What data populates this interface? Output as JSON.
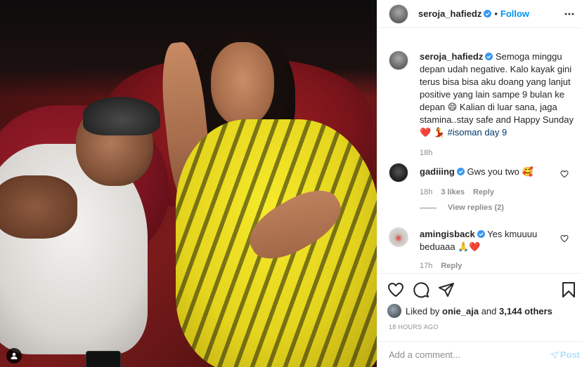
{
  "post": {
    "author": "seroja_hafiedz",
    "follow_label": "Follow",
    "caption_author": "seroja_hafiedz",
    "caption": "Semoga minggu depan udah negative. Kalo kayak gini terus bisa bisa aku doang yang lanjut positive yang lain sampe 9 bulan ke depan 😄 Kalian di luar sana, jaga stamina..stay safe and Happy Sunday",
    "caption_tail": "#isoman day 9",
    "caption_emoji": "❤️ 💃",
    "caption_time": "18h"
  },
  "comments": [
    {
      "username": "gadiiing",
      "text": "Gws you two 🥰",
      "time": "18h",
      "likes": "3 likes",
      "reply": "Reply",
      "view_replies": "View replies (2)"
    },
    {
      "username": "amingisback",
      "text": "Yes kmuuuu beduaaa 🙏❤️",
      "time": "17h",
      "reply": "Reply"
    }
  ],
  "likes": {
    "prefix": "Liked by",
    "user": "onie_aja",
    "joiner": "and",
    "count": "3,144 others"
  },
  "time_ago": "18 HOURS AGO",
  "composer": {
    "placeholder": "Add a comment...",
    "post_label": "Post"
  },
  "colors": {
    "accent": "#0095f6",
    "verified": "#3897f0",
    "heart": "#ed4956",
    "post_disabled": "#b2dffc",
    "muted": "#8e8e8e"
  },
  "icons": [
    "verified-icon",
    "heart-icon",
    "comment-icon",
    "share-icon",
    "bookmark-icon",
    "user-tag-icon"
  ]
}
